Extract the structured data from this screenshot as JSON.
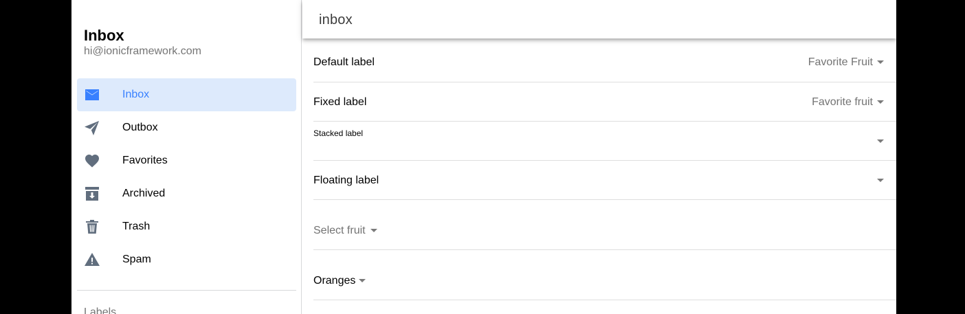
{
  "menu": {
    "title": "Inbox",
    "note": "hi@ionicframework.com",
    "items": [
      {
        "label": "Inbox",
        "icon": "mail-icon",
        "selected": true
      },
      {
        "label": "Outbox",
        "icon": "paper-plane-icon",
        "selected": false
      },
      {
        "label": "Favorites",
        "icon": "heart-icon",
        "selected": false
      },
      {
        "label": "Archived",
        "icon": "archive-icon",
        "selected": false
      },
      {
        "label": "Trash",
        "icon": "trash-icon",
        "selected": false
      },
      {
        "label": "Spam",
        "icon": "warning-icon",
        "selected": false
      }
    ],
    "section_label": "Labels"
  },
  "toolbar": {
    "title": "inbox"
  },
  "form": {
    "default_label": "Default label",
    "default_value": "Favorite Fruit",
    "fixed_label": "Fixed label",
    "fixed_value": "Favorite fruit",
    "stacked_label": "Stacked label",
    "floating_label": "Floating label",
    "select_placeholder": "Select fruit",
    "oranges_value": "Oranges"
  },
  "colors": {
    "accent": "#3880ff",
    "selected_bg": "#ddeafc",
    "icon": "#616e7e",
    "muted_text": "#737373"
  }
}
